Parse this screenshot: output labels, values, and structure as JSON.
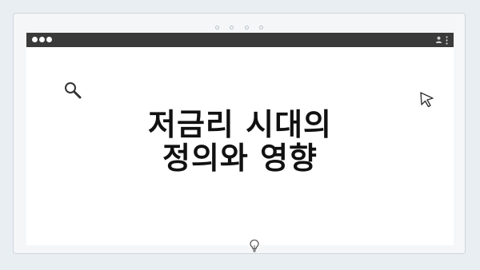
{
  "title_lines": {
    "line1": "저금리 시대의",
    "line2": "정의와 영향"
  },
  "icons": {
    "search": "search-icon",
    "cursor": "cursor-icon",
    "user": "user-icon",
    "menu": "menu-icon",
    "bulb": "lightbulb-icon"
  },
  "colors": {
    "background": "#e9eef2",
    "titlebar": "#3a3a3a",
    "title_text": "#111111"
  }
}
